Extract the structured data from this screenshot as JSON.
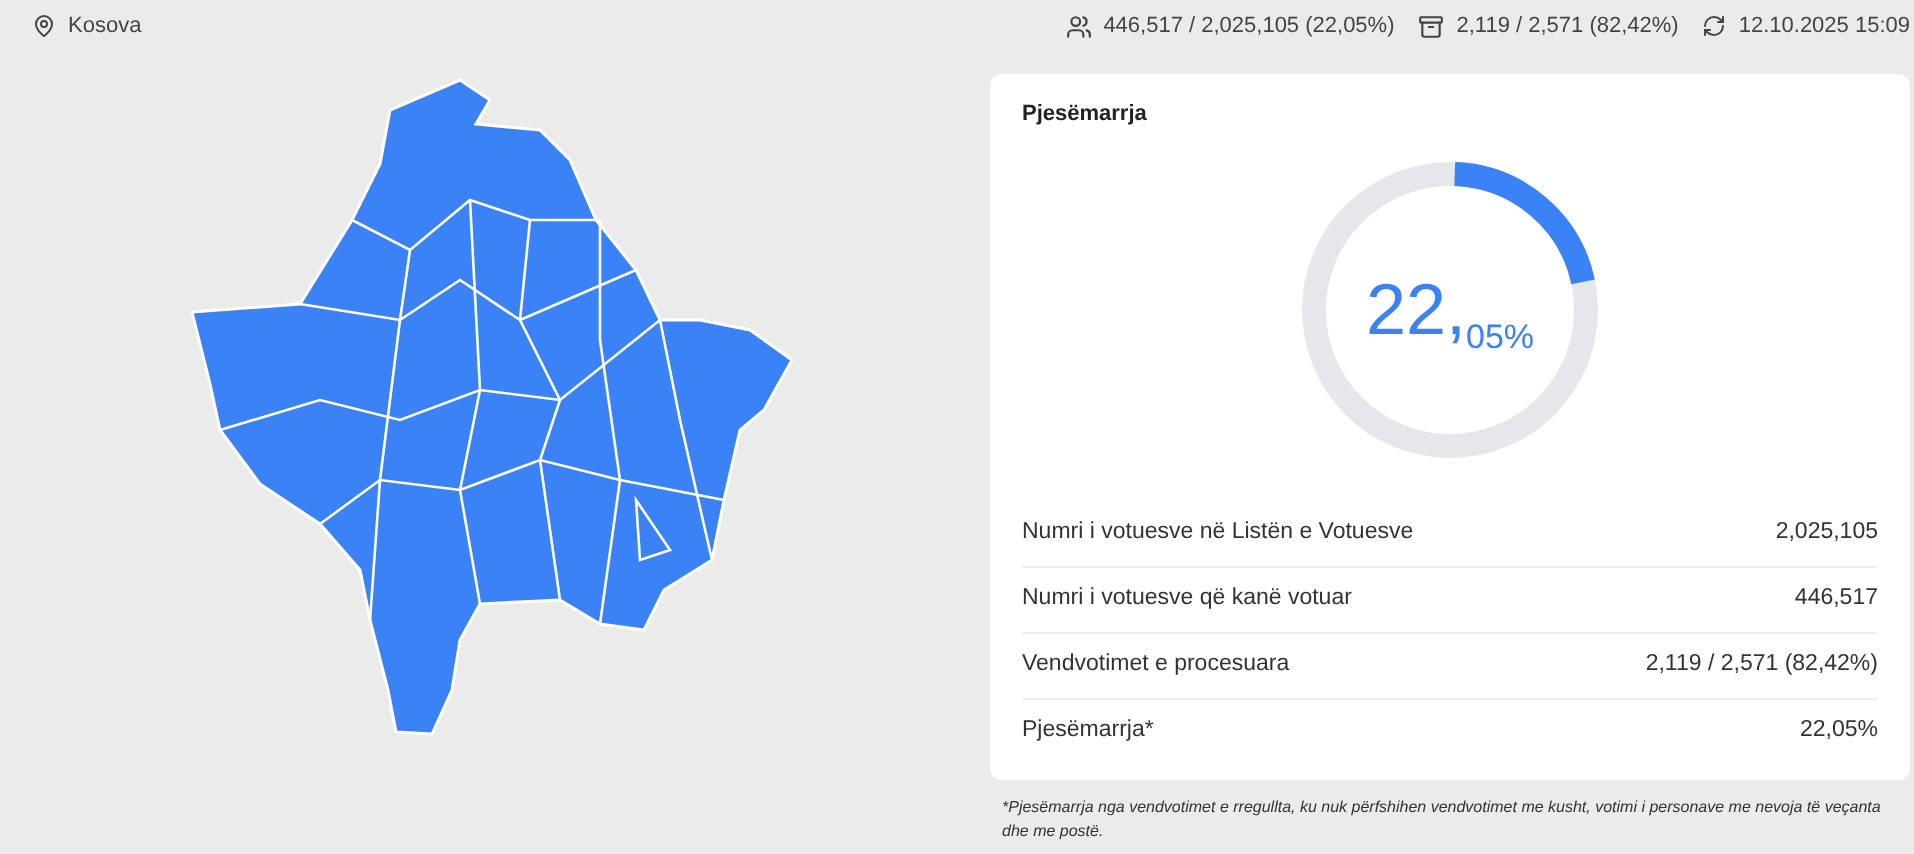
{
  "header": {
    "location": "Kosova",
    "voters": "446,517 / 2,025,105 (22,05%)",
    "stations": "2,119 / 2,571 (82,42%)",
    "updated": "12.10.2025 15:09"
  },
  "turnout": {
    "title": "Pjesëmarrja",
    "level": 0.2205,
    "value_int": "22,",
    "value_dec": "05%"
  },
  "rows": [
    {
      "label": "Numri i votuesve në Listën e Votuesve",
      "value": "2,025,105"
    },
    {
      "label": "Numri i votuesve që kanë votuar",
      "value": "446,517"
    },
    {
      "label": "Vendvotimet e procesuara",
      "value": "2,119 / 2,571 (82,42%)"
    },
    {
      "label": "Pjesëmarrja*",
      "value": "22,05%"
    }
  ],
  "footnote": "*Pjesëmarrja nga vendvotimet e rregullta, ku nuk përfshihen vendvotimet me kusht, votimi i personave me nevoja të veçanta dhe me postë."
}
